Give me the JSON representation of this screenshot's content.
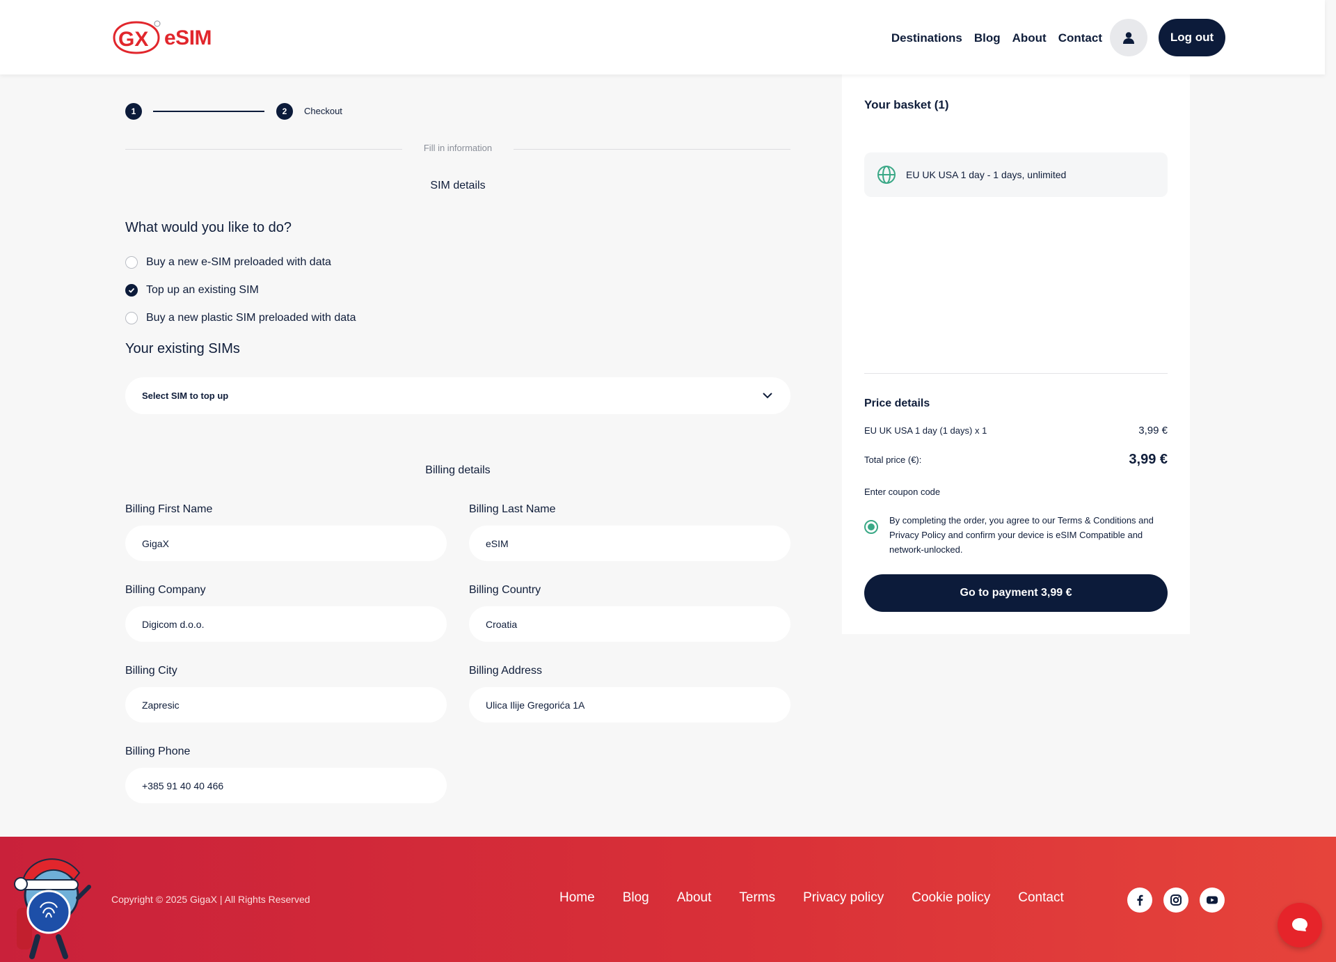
{
  "brand": {
    "logo_mark": "GX",
    "logo_text": "eSIM",
    "logo_color": "#e1262c"
  },
  "nav": {
    "items": [
      "Destinations",
      "Blog",
      "About",
      "Contact"
    ],
    "user_icon": "user-icon",
    "logout_label": "Log out"
  },
  "steps": {
    "step1": "1",
    "step2": "2",
    "step2_label": "Checkout"
  },
  "form": {
    "divider_text": "Fill in information",
    "sim_details_title": "SIM details",
    "question": "What would you like to do?",
    "options": [
      {
        "label": "Buy a new e-SIM preloaded with data",
        "checked": false
      },
      {
        "label": "Top up an existing SIM",
        "checked": true
      },
      {
        "label": "Buy a new plastic SIM preloaded with data",
        "checked": false
      }
    ],
    "existing_sims_title": "Your existing SIMs",
    "select_sim_placeholder": "Select SIM to top up",
    "billing_title": "Billing details",
    "fields": {
      "first_name": {
        "label": "Billing First Name",
        "value": "GigaX"
      },
      "last_name": {
        "label": "Billing Last Name",
        "value": "eSIM"
      },
      "company": {
        "label": "Billing Company",
        "value": "Digicom d.o.o."
      },
      "country": {
        "label": "Billing Country",
        "value": "Croatia"
      },
      "city": {
        "label": "Billing City",
        "value": "Zapresic"
      },
      "address": {
        "label": "Billing Address",
        "value": "Ulica Ilije Gregorića 1A"
      },
      "phone": {
        "label": "Billing Phone",
        "value": "+385 91 40 40 466"
      }
    }
  },
  "basket": {
    "title": "Your basket (1)",
    "item": "EU UK USA 1 day - 1 days, unlimited",
    "item_icon": "globe-icon",
    "price_title": "Price details",
    "line_label": "EU UK USA 1 day (1 days) x 1",
    "line_price": "3,99 €",
    "total_label": "Total price (€):",
    "total_price": "3,99 €",
    "coupon_label": "Enter coupon code",
    "agreement": "By completing the order, you agree to our Terms & Conditions and Privacy Policy and confirm your device is eSIM Compatible and network-unlocked.",
    "pay_button": "Go to payment 3,99 €"
  },
  "footer": {
    "copyright": "Copyright © 2025 GigaX | All Rights Reserved",
    "links": [
      "Home",
      "Blog",
      "About",
      "Terms",
      "Privacy policy",
      "Cookie policy",
      "Contact"
    ],
    "social_icons": [
      "facebook-icon",
      "instagram-icon",
      "youtube-icon"
    ],
    "chat_icon": "chat-bubble-icon"
  },
  "colors": {
    "primary": "#0c1b3a",
    "accent_red": "#e1262c",
    "agree_green": "#3aa886"
  }
}
